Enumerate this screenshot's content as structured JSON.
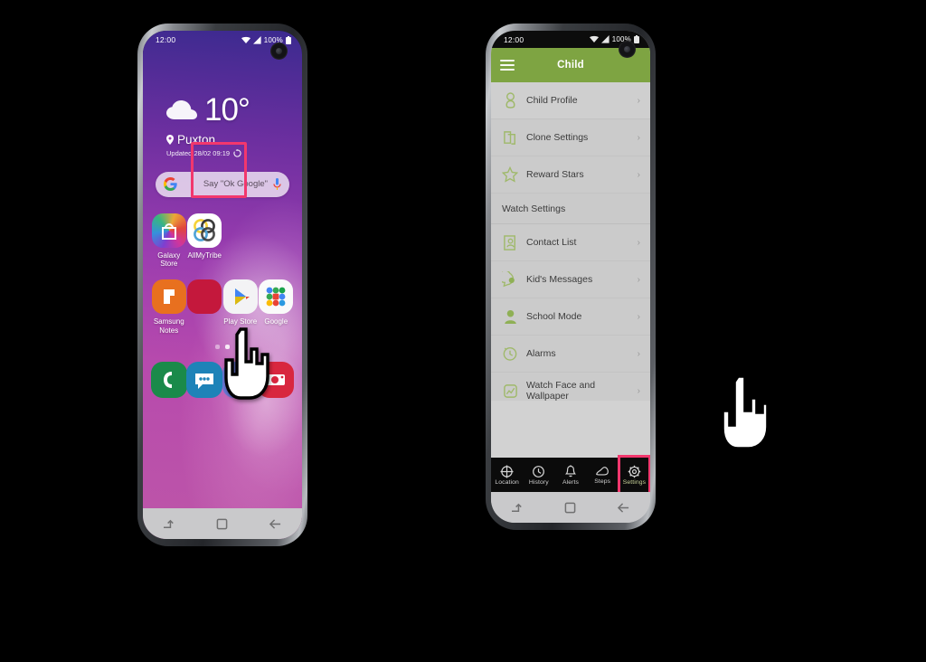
{
  "left_phone": {
    "status_bar": {
      "time": "12:00",
      "battery": "100%",
      "icons": [
        "wifi-icon",
        "signal-icon",
        "battery-icon"
      ]
    },
    "weather": {
      "icon": "cloud-icon",
      "temperature": "10°",
      "location": "Puxton",
      "location_icon": "map-pin-icon",
      "updated": "Updated 28/02 09:19",
      "refresh_icon": "refresh-icon"
    },
    "search": {
      "logo": "google-g-icon",
      "hint": "Say \"Ok Google\"",
      "mic_icon": "microphone-icon"
    },
    "apps_row1": [
      {
        "label": "Galaxy Store",
        "icon": "galaxy-store-icon",
        "highlighted": false
      },
      {
        "label": "AllMyTribe",
        "icon": "allmytribe-icon",
        "highlighted": true
      },
      {
        "label": "",
        "icon": "none",
        "highlighted": false
      },
      {
        "label": "",
        "icon": "none",
        "highlighted": false
      }
    ],
    "apps_row2": [
      {
        "label": "Samsung Notes",
        "icon": "samsung-notes-icon"
      },
      {
        "label": "",
        "icon": "hidden-under-cursor-icon"
      },
      {
        "label": "Play Store",
        "icon": "play-store-icon"
      },
      {
        "label": "Google",
        "icon": "google-folder-icon"
      }
    ],
    "page_indicator": {
      "count": 2,
      "active": 1
    },
    "dock": [
      {
        "label": "",
        "icon": "phone-icon"
      },
      {
        "label": "",
        "icon": "messages-icon"
      },
      {
        "label": "",
        "icon": "internet-icon"
      },
      {
        "label": "",
        "icon": "camera-icon"
      }
    ],
    "nav_bar": [
      {
        "icon": "recents-icon"
      },
      {
        "icon": "home-icon"
      },
      {
        "icon": "back-icon"
      }
    ]
  },
  "right_phone": {
    "status_bar": {
      "time": "12:00",
      "battery": "100%",
      "icons": [
        "wifi-icon",
        "signal-icon",
        "battery-icon"
      ]
    },
    "app_bar": {
      "menu_icon": "hamburger-menu-icon",
      "title": "Child",
      "color": "#7ea442"
    },
    "list": [
      {
        "type": "item",
        "label": "Child Profile",
        "icon": "child-profile-icon"
      },
      {
        "type": "item",
        "label": "Clone Settings",
        "icon": "clone-settings-icon"
      },
      {
        "type": "item",
        "label": "Reward Stars",
        "icon": "star-icon"
      },
      {
        "type": "header",
        "label": "Watch Settings",
        "icon": "none"
      },
      {
        "type": "item",
        "label": "Contact List",
        "icon": "contact-list-icon"
      },
      {
        "type": "item",
        "label": "Kid's Messages",
        "icon": "kids-messages-icon"
      },
      {
        "type": "item",
        "label": "School Mode",
        "icon": "school-mode-icon"
      },
      {
        "type": "item",
        "label": "Alarms",
        "icon": "alarm-clock-icon"
      },
      {
        "type": "item",
        "label": "Watch Face and Wallpaper",
        "icon": "watch-face-icon"
      }
    ],
    "tab_bar": [
      {
        "label": "Location",
        "icon": "location-crosshair-icon",
        "selected": false
      },
      {
        "label": "History",
        "icon": "clock-icon",
        "selected": false
      },
      {
        "label": "Alerts",
        "icon": "bell-icon",
        "selected": false
      },
      {
        "label": "Steps",
        "icon": "shoe-icon",
        "selected": false
      },
      {
        "label": "Settings",
        "icon": "gear-icon",
        "selected": true
      }
    ],
    "nav_bar": [
      {
        "icon": "recents-icon"
      },
      {
        "icon": "home-icon"
      },
      {
        "icon": "back-icon"
      }
    ]
  },
  "annotations": {
    "highlight_color": "#f2376d",
    "cursors": [
      {
        "name": "hand-cursor-left",
        "target": "AllMyTribe"
      },
      {
        "name": "hand-cursor-right",
        "target": "Settings"
      }
    ]
  },
  "colors": {
    "accent_green": "#7ea442",
    "highlight_pink": "#f2376d",
    "background": "#000000"
  }
}
